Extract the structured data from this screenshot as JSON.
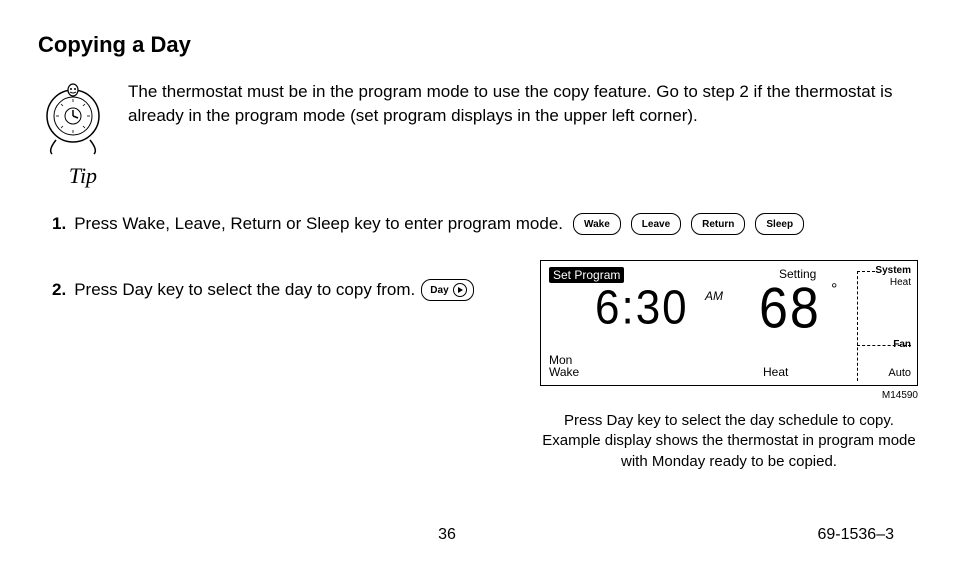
{
  "title": "Copying a Day",
  "tip": {
    "label": "Tip",
    "text": "The thermostat must be in the program mode to use the copy feature. Go to step 2 if the thermostat is already in the program mode (set program displays in the upper left corner)."
  },
  "steps": {
    "s1": {
      "num": "1.",
      "text": "Press Wake, Leave, Return or Sleep key to enter program mode."
    },
    "s2": {
      "num": "2.",
      "text": "Press Day key to select the day to copy from."
    }
  },
  "keys": {
    "wake": "Wake",
    "leave": "Leave",
    "return": "Return",
    "sleep": "Sleep",
    "day": "Day"
  },
  "lcd": {
    "setprogram": "Set Program",
    "setting": "Setting",
    "system": "System",
    "heat_small": "Heat",
    "fan": "Fan",
    "auto": "Auto",
    "day": "Mon",
    "period": "Wake",
    "mode": "Heat",
    "time": "6:30",
    "ampm": "AM",
    "temp": "68",
    "deg": "°"
  },
  "mcode": "M14590",
  "caption": "Press Day key to select the day schedule to copy. Example display shows the thermostat in program mode with Monday ready to be copied.",
  "footer": {
    "page": "36",
    "doc": "69-1536–3"
  }
}
